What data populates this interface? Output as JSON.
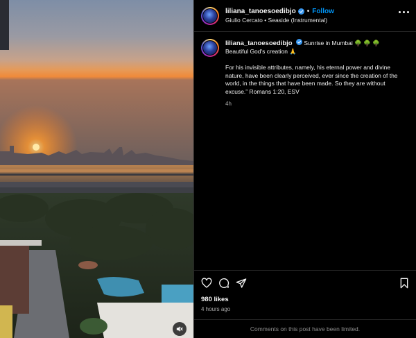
{
  "post": {
    "username": "liliana_tanoesoedibjo",
    "follow_label": "Follow",
    "audio": "Giulio Cercato • Seaside (Instrumental)"
  },
  "caption": {
    "username": "liliana_tanoesoedibjo",
    "line1": "Sunrise in Mumbai 🌳 🌳 🌳",
    "line2": "Beautiful God's creation 🙏",
    "verse": "For his invisible attributes, namely, his eternal power and divine nature, have been clearly perceived, ever since the creation of the world, in the things that have been made. So they are without excuse.” Romans 1:20, ESV",
    "time": "4h"
  },
  "engagement": {
    "likes": "980 likes",
    "posted": "4 hours ago"
  },
  "comments_notice": "Comments on this post have been limited.",
  "icons": {
    "like": "heart-icon",
    "comment": "comment-icon",
    "share": "share-icon",
    "save": "bookmark-icon",
    "more": "more-icon",
    "mute": "speaker-muted-icon",
    "verified": "verified-badge-icon"
  },
  "colors": {
    "background": "#000000",
    "link": "#0095f6",
    "verified": "#3897f0",
    "muted_text": "#a8a8a8"
  }
}
